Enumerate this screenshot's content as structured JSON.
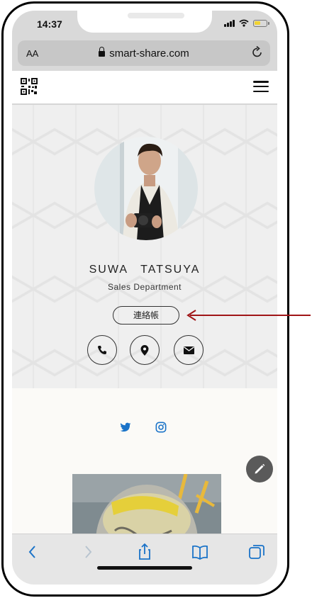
{
  "status": {
    "time": "14:37"
  },
  "browser": {
    "text_size_label": "AA",
    "url": "smart-share.com"
  },
  "profile": {
    "name": "SUWA　TATSUYA",
    "department": "Sales Department",
    "contact_button": "連絡帳"
  },
  "colors": {
    "arrow": "#a01517",
    "accent_link": "#1a73c8",
    "fab": "#5a5a5a"
  },
  "icons": [
    "phone-icon",
    "map-pin-icon",
    "mail-icon",
    "twitter-icon",
    "instagram-icon",
    "pencil-icon",
    "back-icon",
    "forward-icon",
    "share-icon",
    "bookmarks-icon",
    "tabs-icon",
    "qr-code-icon",
    "menu-icon",
    "reload-icon",
    "lock-icon"
  ]
}
